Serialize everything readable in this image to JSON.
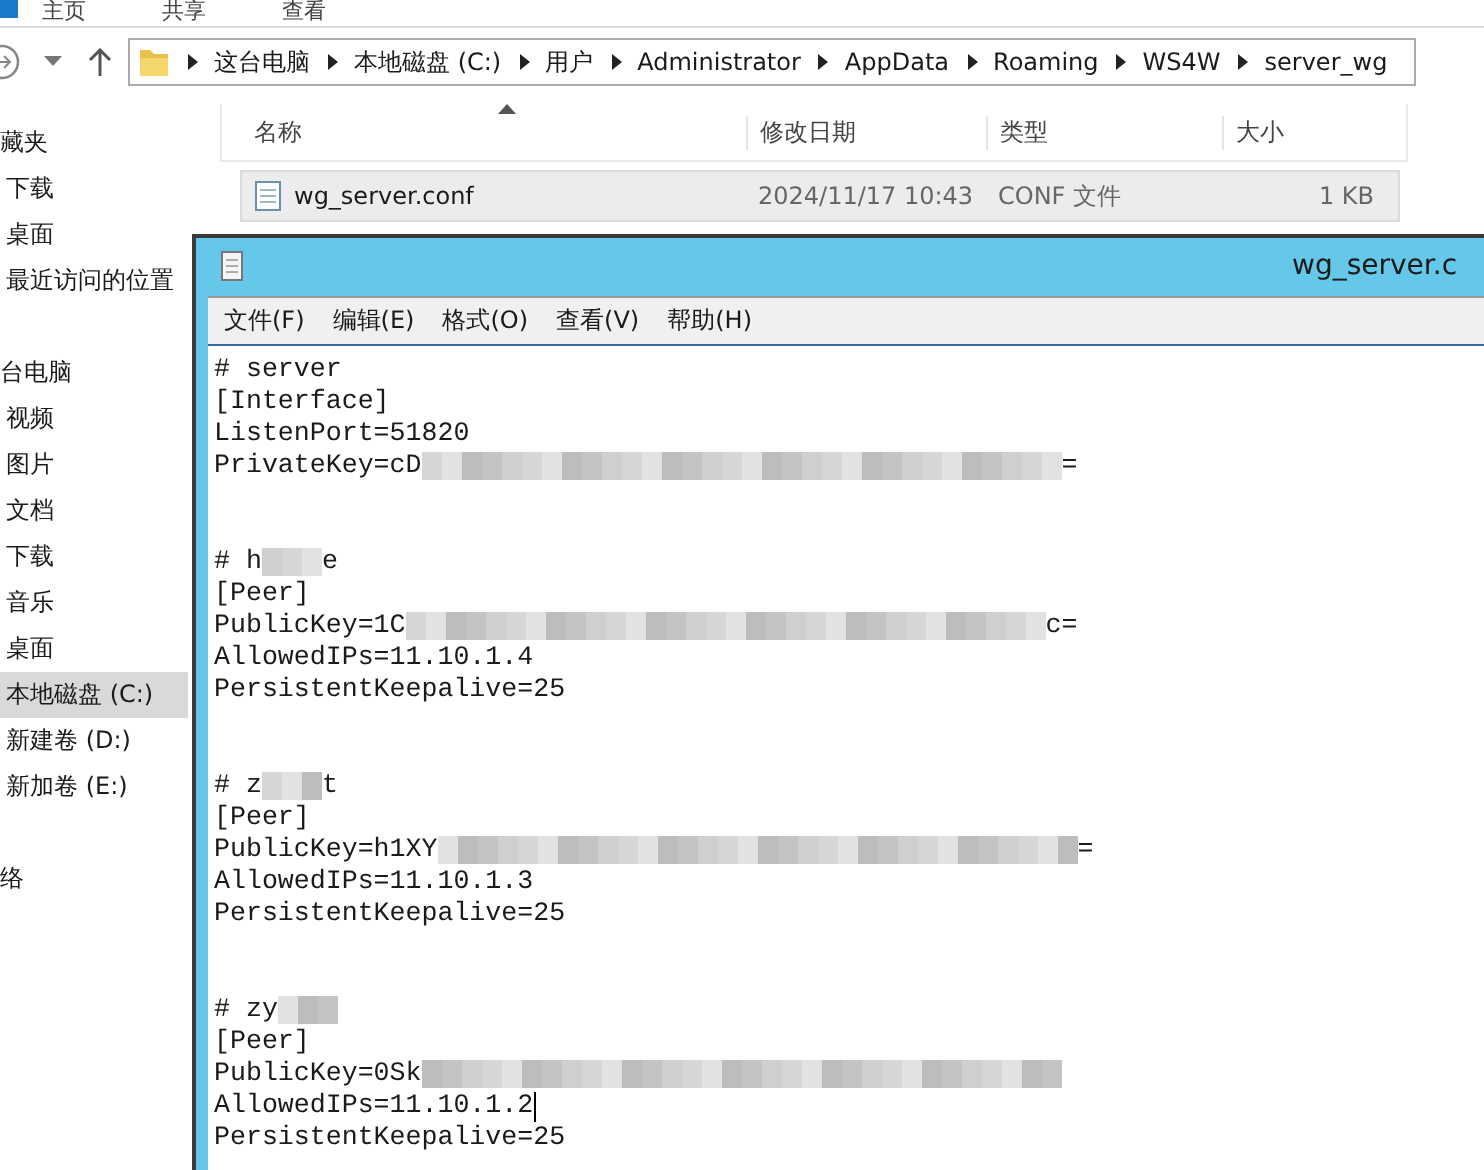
{
  "ribbon": {
    "tabs": [
      "主页",
      "共享",
      "查看"
    ]
  },
  "address_bar": {
    "crumbs": [
      "这台电脑",
      "本地磁盘 (C:)",
      "用户",
      "Administrator",
      "AppData",
      "Roaming",
      "WS4W",
      "server_wg"
    ]
  },
  "sidebar": {
    "items": [
      {
        "label": "藏夹",
        "kind": "header",
        "selected": false
      },
      {
        "label": "下载",
        "kind": "item",
        "selected": false
      },
      {
        "label": "桌面",
        "kind": "item",
        "selected": false
      },
      {
        "label": "最近访问的位置",
        "kind": "item",
        "selected": false
      },
      {
        "kind": "gap"
      },
      {
        "label": "台电脑",
        "kind": "header",
        "selected": false
      },
      {
        "label": "视频",
        "kind": "item",
        "selected": false
      },
      {
        "label": "图片",
        "kind": "item",
        "selected": false
      },
      {
        "label": "文档",
        "kind": "item",
        "selected": false
      },
      {
        "label": "下载",
        "kind": "item",
        "selected": false
      },
      {
        "label": "音乐",
        "kind": "item",
        "selected": false
      },
      {
        "label": "桌面",
        "kind": "item",
        "selected": false
      },
      {
        "label": "本地磁盘 (C:)",
        "kind": "item",
        "selected": true
      },
      {
        "label": "新建卷 (D:)",
        "kind": "item",
        "selected": false
      },
      {
        "label": "新加卷 (E:)",
        "kind": "item",
        "selected": false
      },
      {
        "kind": "gap"
      },
      {
        "label": "络",
        "kind": "header",
        "selected": false
      }
    ]
  },
  "file_list": {
    "columns": [
      "名称",
      "修改日期",
      "类型",
      "大小"
    ],
    "rows": [
      {
        "name": "wg_server.conf",
        "modified": "2024/11/17 10:43",
        "type": "CONF 文件",
        "size": "1 KB",
        "selected": true
      }
    ]
  },
  "notepad": {
    "title": "wg_server.c",
    "menu": [
      "文件(F)",
      "编辑(E)",
      "格式(O)",
      "查看(V)",
      "帮助(H)"
    ],
    "lines": [
      {
        "kind": "text",
        "text": "# server"
      },
      {
        "kind": "text",
        "text": "[Interface]"
      },
      {
        "kind": "text",
        "text": "ListenPort=51820"
      },
      {
        "kind": "key",
        "text": "PrivateKey=cD",
        "suffix": "="
      },
      {
        "kind": "blank"
      },
      {
        "kind": "blank"
      },
      {
        "kind": "name",
        "text": "# h",
        "suffix": "e"
      },
      {
        "kind": "text",
        "text": "[Peer]"
      },
      {
        "kind": "key",
        "text": "PublicKey=1C",
        "suffix": "c="
      },
      {
        "kind": "text",
        "text": "AllowedIPs=11.10.1.4"
      },
      {
        "kind": "text",
        "text": "PersistentKeepalive=25"
      },
      {
        "kind": "blank"
      },
      {
        "kind": "blank"
      },
      {
        "kind": "name",
        "text": "# z",
        "suffix": "t"
      },
      {
        "kind": "text",
        "text": "[Peer]"
      },
      {
        "kind": "key",
        "text": "PublicKey=h1XY",
        "suffix": "="
      },
      {
        "kind": "text",
        "text": "AllowedIPs=11.10.1.3"
      },
      {
        "kind": "text",
        "text": "PersistentKeepalive=25"
      },
      {
        "kind": "blank"
      },
      {
        "kind": "blank"
      },
      {
        "kind": "name",
        "text": "# zy"
      },
      {
        "kind": "text",
        "text": "[Peer]"
      },
      {
        "kind": "key",
        "text": "PublicKey=0Sk"
      },
      {
        "kind": "text",
        "text": "AllowedIPs=11.10.1.2",
        "cursor": true
      },
      {
        "kind": "text",
        "text": "PersistentKeepalive=25"
      }
    ]
  }
}
